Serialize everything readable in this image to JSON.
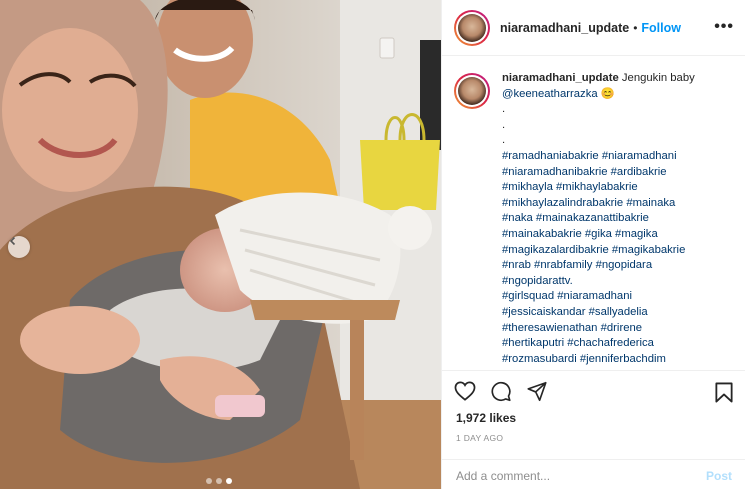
{
  "post": {
    "username": "niaramadhani_update",
    "separator": "•",
    "follow_label": "Follow",
    "more_label": "•••",
    "caption": {
      "text": "Jengukin baby",
      "mention": "@keeneatharrazka",
      "emoji": "😊",
      "dots": [
        ".",
        ".",
        "."
      ],
      "hashtag_lines": [
        "#ramadhaniabakrie #niaramadhani",
        "#niaramadhanibakrie #ardibakrie",
        "#mikhayla #mikhaylabakrie",
        "#mikhaylazalindrabakrie #mainaka",
        "#naka #mainakazanattibakrie",
        "#mainakabakrie #gika #magika",
        "#magikazalardibakrie #magikabakrie",
        "#nrab #nrabfamily #ngopidara",
        "#ngopidarattv.",
        "#girlsquad #niaramadhani",
        "#jessicaiskandar #sallyadelia",
        "#theresawienathan #drirene",
        "#hertikaputri #chachafrederica",
        "#rozmasubardi #jenniferbachdim"
      ]
    },
    "likes": "1,972 likes",
    "date": "1 DAY AGO",
    "add_comment_placeholder": "Add a comment...",
    "post_label": "Post"
  },
  "carousel": {
    "dot_count": 3,
    "active_index": 2
  },
  "icons": {
    "avatar": "profile-avatar",
    "like": "heart-icon",
    "comment": "comment-icon",
    "share": "paper-plane-icon",
    "save": "bookmark-icon",
    "prev": "chevron-left-icon"
  },
  "colors": {
    "follow": "#0095f6",
    "hashtag": "#00376b",
    "post_disabled": "#b2dffc",
    "muted": "#8e8e8e"
  }
}
